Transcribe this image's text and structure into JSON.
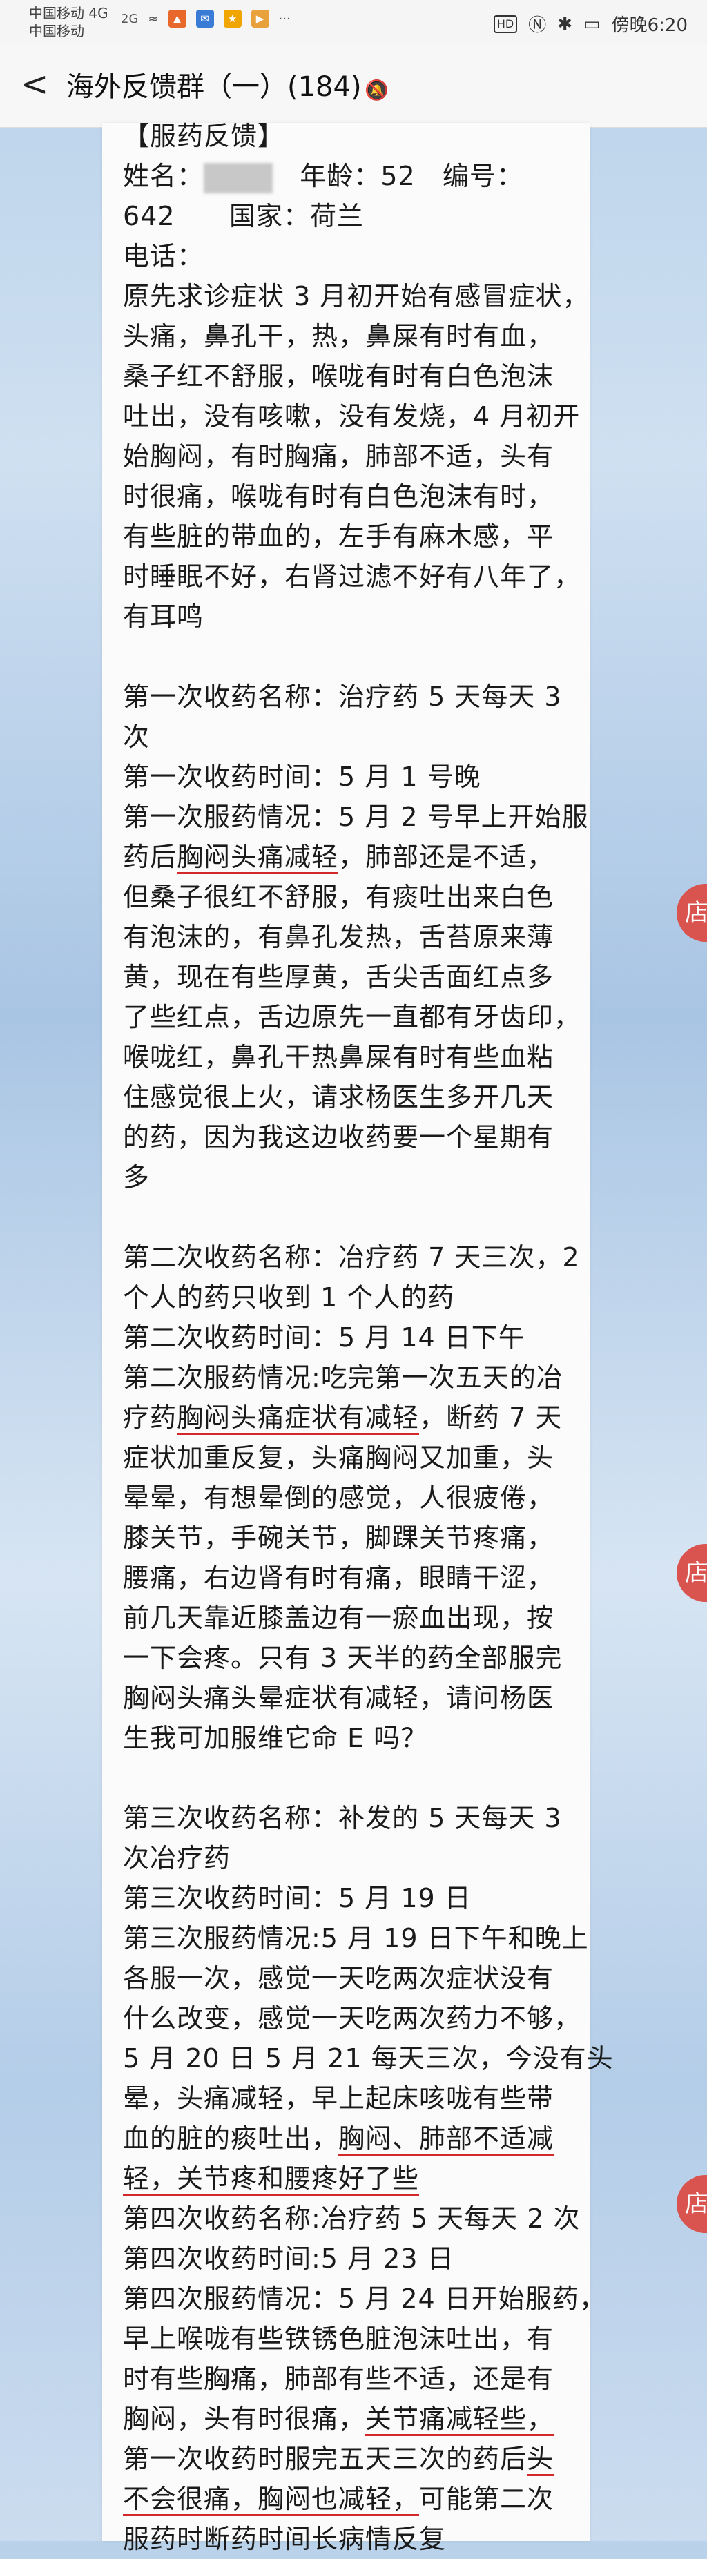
{
  "status_bar": {
    "carrier1": "中国移动 4G",
    "carrier2": "中国移动",
    "signal2": "2G",
    "time": "傍晚6:20",
    "hd_badge": "HD"
  },
  "nav": {
    "title": "海外反馈群（一）(184)"
  },
  "side_button_label": "店",
  "content": {
    "header": "【服药反馈】",
    "info1": {
      "name_label": "姓名：",
      "age": "年龄：52",
      "id_label": "编号："
    },
    "info2": {
      "id_value": "642",
      "country": "国家：荷兰"
    },
    "phone": "电话：",
    "symptoms": [
      "原先求诊症状 3 月初开始有感冒症状，",
      "头痛，鼻孔干，热，鼻屎有时有血，",
      "桑子红不舒服，喉咙有时有白色泡沫",
      "吐出，没有咳嗽，没有发烧，4 月初开",
      "始胸闷，有时胸痛，肺部不适，头有",
      "时很痛，喉咙有时有白色泡沫有时，",
      "有些脏的带血的，左手有麻木感，平",
      "时睡眠不好，右肾过滤不好有八年了，",
      "有耳鸣"
    ],
    "first": {
      "name_l1": "第一次收药名称：治疗药 5 天每天 3",
      "name_l2": "次",
      "time": "第一次收药时间：5 月 1 号晚",
      "s1": "第一次服药情况：5 月 2 号早上开始服",
      "s2a": "药后",
      "s2u": "胸闷头痛减轻",
      "s2b": "，肺部还是不适，",
      "rest": [
        "但桑子很红不舒服，有痰吐出来白色",
        "有泡沫的，有鼻孔发热，舌苔原来薄",
        "黄，现在有些厚黄，舌尖舌面红点多",
        "了些红点，舌边原先一直都有牙齿印，",
        "喉咙红，鼻孔干热鼻屎有时有些血粘",
        "住感觉很上火，请求杨医生多开几天",
        "的药，因为我这边收药要一个星期有",
        "多"
      ]
    },
    "second": {
      "name_l1": "第二次收药名称：冶疗药 7 天三次，2",
      "name_l2": "个人的药只收到 1 个人的药",
      "time": "第二次收药时间：5 月 14 日下午",
      "s1": "第二次服药情况:吃完第一次五天的冶",
      "s2a": "疗药",
      "s2u": "胸闷头痛症状有减轻",
      "s2b": "，断药 7 天",
      "s3": "症状加重反复，头痛胸闷又加重，头",
      "rest": [
        "晕晕，有想晕倒的感觉，人很疲倦，",
        "膝关节，手碗关节，脚踝关节疼痛，",
        "腰痛，右边肾有时有痛，眼睛干涩，",
        "前几天靠近膝盖边有一瘀血出现，按",
        "一下会疼。只有 3 天半的药全部服完",
        "胸闷头痛头晕症状有减轻，请问杨医",
        "生我可加服维它命 E 吗？"
      ]
    },
    "third": {
      "name_l1": "第三次收药名称：补发的 5 天每天 3",
      "name_l2": "次冶疗药",
      "time": "第三次收药时间：5 月 19 日",
      "rest": [
        "第三次服药情况:5 月 19 日下午和晚上",
        "各服一次，感觉一天吃两次症状没有",
        "什么改变，感觉一天吃两次药力不够，",
        "5 月 20 日 5 月 21 每天三次，今没有头",
        "晕，头痛减轻，早上起床咳咙有些带"
      ],
      "u1a": "血的脏的痰吐出，",
      "u1u": "胸闷、肺部不适减",
      "u2u": "轻，关节疼和腰疼好了些"
    },
    "fourth": {
      "name": "第四次收药名称:冶疗药 5 天每天 2 次",
      "time": "第四次收药时间:5 月 23 日",
      "rest": [
        "第四次服药情况：5 月 24 日开始服药，",
        "早上喉咙有些铁锈色脏泡沫吐出，有",
        "时有些胸痛，肺部有些不适，还是有"
      ],
      "l4a": "胸闷，头有时很痛，",
      "l4u": "关节痛减轻些，",
      "l5a": "第一次收药时服完五天三次的药后",
      "l5u": "头",
      "l6u": "不会很痛，胸闷也减轻，",
      "l6b": "可能第二次",
      "last": "服药时断药时间长病情反复"
    }
  }
}
